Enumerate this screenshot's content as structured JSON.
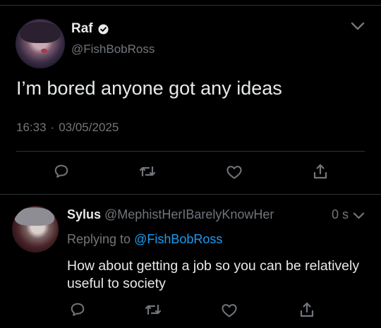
{
  "main_tweet": {
    "display_name": "Raf",
    "handle": "@FishBobRoss",
    "text": "I’m bored anyone got any ideas",
    "time": "16:33",
    "separator": "·",
    "date": "03/05/2025"
  },
  "reply": {
    "display_name": "Sylus",
    "handle": "@MephistHerIBarelyKnowHer",
    "time": "0 s",
    "replying_prefix": "Replying to",
    "replying_handle": "@FishBobRoss",
    "text": "How about getting a job so you can be relatively useful to society"
  },
  "colors": {
    "background": "#000000",
    "text_primary": "#e7e9ea",
    "text_secondary": "#71767b",
    "link": "#1d9bf0",
    "divider": "#2f3336"
  },
  "icons": {
    "verified": "verified-badge-icon",
    "more": "chevron-down-icon",
    "reply": "reply-bubble-icon",
    "retweet": "retweet-icon",
    "like": "heart-icon",
    "share": "share-icon"
  }
}
